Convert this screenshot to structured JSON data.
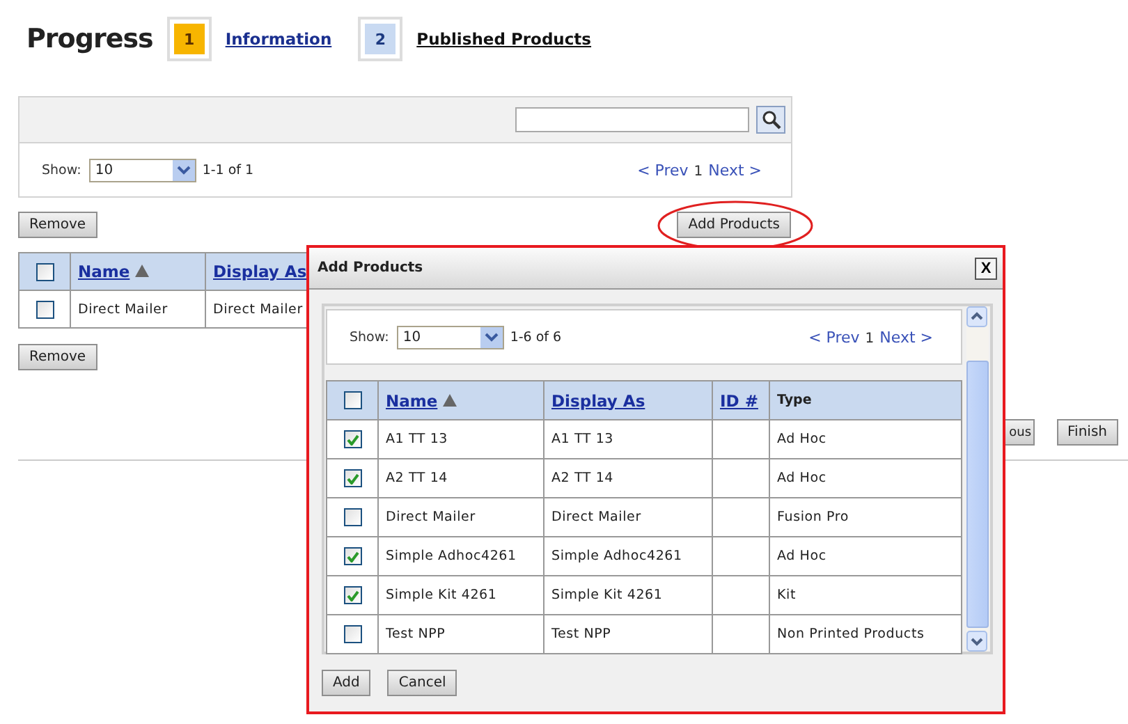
{
  "header": {
    "title": "Progress",
    "steps": [
      {
        "number": "1",
        "label": "Information",
        "selected": true
      },
      {
        "number": "2",
        "label": "Published Products",
        "selected": false
      }
    ]
  },
  "list_panel": {
    "show_label": "Show:",
    "page_size": "10",
    "range": "1-1 of 1",
    "pager": {
      "prev": "< Prev",
      "page": "1",
      "next": "Next >"
    }
  },
  "add_button": {
    "label": "Add Products",
    "highlighted": true
  },
  "remove_buttons": [
    "Remove",
    "Remove"
  ],
  "table": {
    "select_all": false,
    "columns": [
      {
        "label": "Name",
        "sorted": true
      },
      {
        "label": "Display As",
        "sorted": false
      }
    ],
    "rows": [
      {
        "checked": false,
        "name": "Direct Mailer",
        "display_as": "Direct Mailer"
      }
    ]
  },
  "nav_buttons": [
    "ous",
    "Finish"
  ],
  "dialog": {
    "title": "Add Products",
    "close": "X",
    "show_label": "Show:",
    "page_size": "10",
    "range": "1-6 of 6",
    "pager": {
      "prev": "< Prev",
      "page": "1",
      "next": "Next >"
    },
    "select_all": false,
    "columns": [
      {
        "label": "Name",
        "kind": "link",
        "sorted": true
      },
      {
        "label": "Display As",
        "kind": "link",
        "sorted": false
      },
      {
        "label": "ID #",
        "kind": "link",
        "sorted": false
      },
      {
        "label": "Type",
        "kind": "plain",
        "sorted": false
      }
    ],
    "rows": [
      {
        "checked": true,
        "name": "A1 TT 13",
        "display_as": "A1 TT 13",
        "type": "Ad Hoc"
      },
      {
        "checked": true,
        "name": "A2 TT 14",
        "display_as": "A2 TT 14",
        "type": "Ad Hoc"
      },
      {
        "checked": false,
        "name": "Direct Mailer",
        "display_as": "Direct Mailer",
        "type": "Fusion Pro"
      },
      {
        "checked": true,
        "name": "Simple Adhoc4261",
        "display_as": "Simple Adhoc4261",
        "type": "Ad Hoc"
      },
      {
        "checked": true,
        "name": "Simple Kit 4261",
        "display_as": "Simple Kit 4261",
        "type": "Kit"
      },
      {
        "checked": false,
        "name": "Test NPP",
        "display_as": "Test NPP",
        "type": "Non Printed Products"
      }
    ],
    "buttons": [
      "Add",
      "Cancel"
    ]
  }
}
